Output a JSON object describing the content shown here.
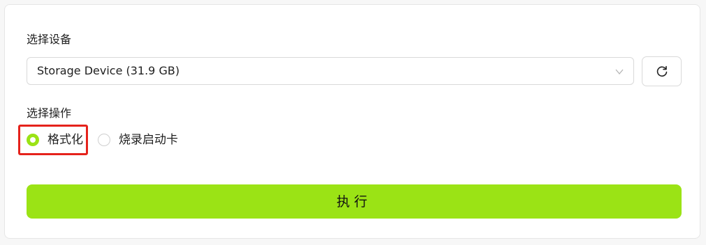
{
  "device_section": {
    "label": "选择设备",
    "selected_device": "Storage Device (31.9 GB)",
    "chevron_icon": "chevron-down-icon",
    "refresh_icon": "refresh-icon"
  },
  "operation_section": {
    "label": "选择操作",
    "options": [
      {
        "label": "格式化",
        "checked": true
      },
      {
        "label": "烧录启动卡",
        "checked": false
      }
    ]
  },
  "execute_button": {
    "label": "执行"
  },
  "colors": {
    "accent": "#9be315",
    "highlight": "#e5221b"
  }
}
